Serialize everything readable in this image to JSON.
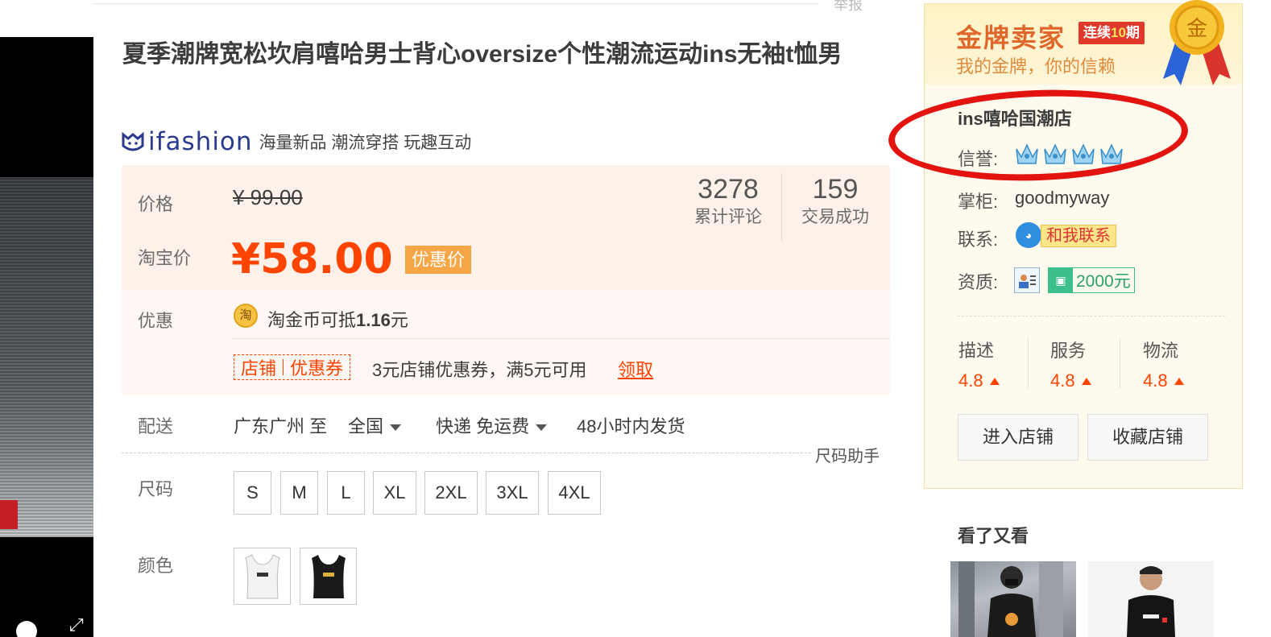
{
  "header": {
    "report_label": "举报"
  },
  "product": {
    "title": "夏季潮牌宽松坎肩嘻哈男士背心oversize个性潮流运动ins无袖t恤男",
    "brand_name": "ifashion",
    "brand_slogan": "海量新品 潮流穿搭 玩趣互动"
  },
  "price": {
    "price_label": "价格",
    "original_price": "¥ 99.00",
    "taobao_label": "淘宝价",
    "taobao_price": "¥58.00",
    "discount_tag": "优惠价",
    "stats": [
      {
        "value": "3278",
        "label": "累计评论"
      },
      {
        "value": "159",
        "label": "交易成功"
      }
    ]
  },
  "promotion": {
    "label": "优惠",
    "coin_icon": "淘",
    "coin_text": "淘金币可抵",
    "coin_amount": "1.16",
    "coin_unit": "元",
    "coupon_tag_shop": "店铺",
    "coupon_tag_coupon": "优惠券",
    "coupon_text": "3元店铺优惠券，满5元可用",
    "coupon_claim": "领取"
  },
  "shipping": {
    "label": "配送",
    "from": "广东广州 至",
    "to": "全国",
    "method": "快递 免运费",
    "dispatch": "48小时内发货",
    "size_helper": "尺码助手"
  },
  "options": {
    "size_label": "尺码",
    "sizes": [
      "S",
      "M",
      "L",
      "XL",
      "2XL",
      "3XL",
      "4XL"
    ],
    "color_label": "颜色",
    "colors": [
      "white-tank",
      "black-tank"
    ]
  },
  "shop": {
    "gold_title": "金牌卖家",
    "streak_prefix": "连续",
    "streak_number": "10",
    "streak_suffix": "期",
    "gold_subtitle": "我的金牌，你的信赖",
    "medal_char": "金",
    "name": "ins嘻哈国潮店",
    "credit_label": "信誉:",
    "keeper_label": "掌柜:",
    "keeper_name": "goodmyway",
    "contact_label": "联系:",
    "contact_button": "和我联系",
    "qual_label": "资质:",
    "deposit": "2000元",
    "scores": [
      {
        "label": "描述",
        "value": "4.8"
      },
      {
        "label": "服务",
        "value": "4.8"
      },
      {
        "label": "物流",
        "value": "4.8"
      }
    ],
    "enter_shop": "进入店铺",
    "fav_shop": "收藏店铺",
    "seen_title": "看了又看"
  },
  "colors": {
    "accent": "#ff4400",
    "gold": "#e0672b",
    "annotation": "#e3140f"
  }
}
